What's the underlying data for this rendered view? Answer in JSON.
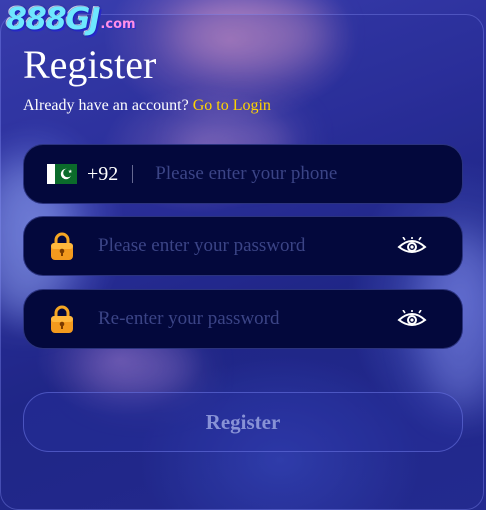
{
  "brand": {
    "logo_text": "888GJ",
    "logo_suffix": ".com"
  },
  "form": {
    "title": "Register",
    "login_prompt": "Already have an account?",
    "login_link": "Go to Login",
    "phone": {
      "flag_icon": "pakistan-flag-icon",
      "country_code": "+92",
      "placeholder": "Please enter your phone",
      "value": ""
    },
    "password": {
      "icon": "lock-icon",
      "placeholder": "Please enter your password",
      "value": "",
      "toggle_icon": "eye-icon"
    },
    "confirm_password": {
      "icon": "lock-icon",
      "placeholder": "Re-enter your password",
      "value": "",
      "toggle_icon": "eye-icon"
    },
    "submit_label": "Register"
  },
  "colors": {
    "link": "#ffd400",
    "field_bg": "#03083c",
    "placeholder": "#3b4486",
    "lock_orange": "#f39a1e"
  }
}
